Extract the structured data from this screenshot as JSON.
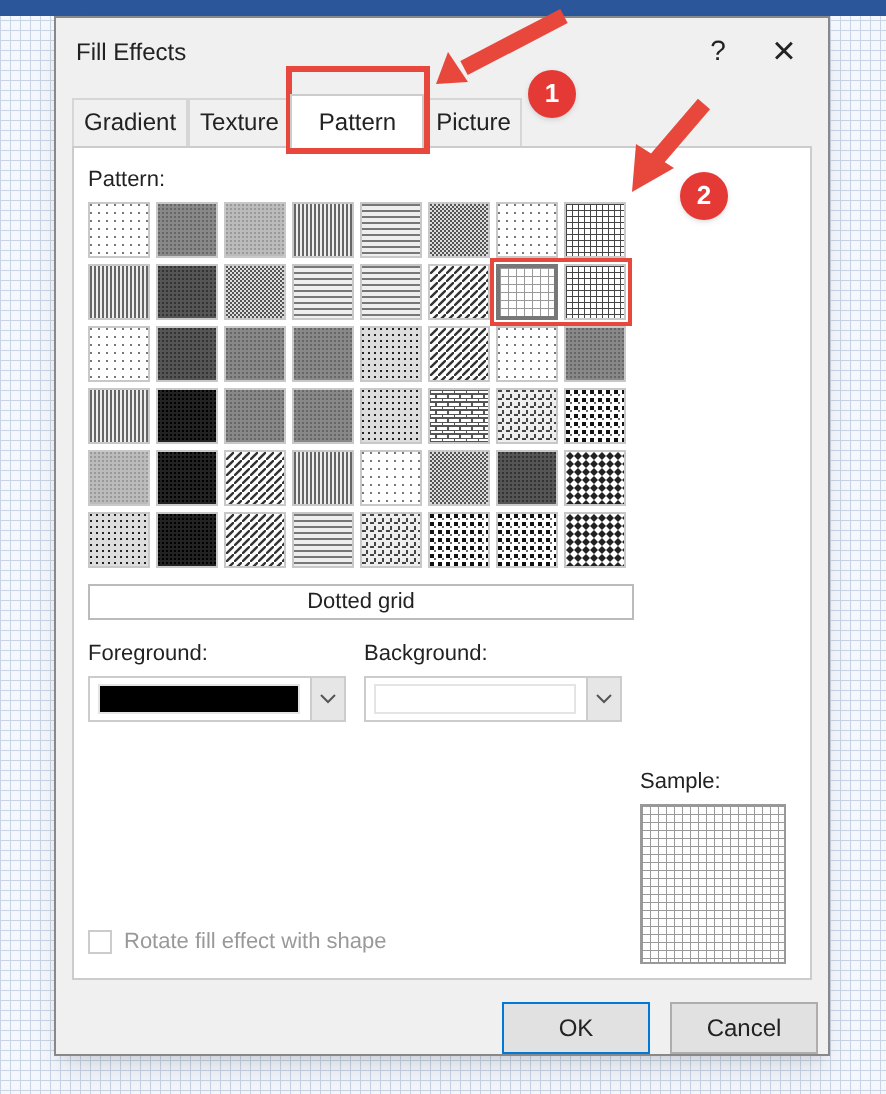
{
  "window": {
    "title": "Fill Effects",
    "help": "?",
    "close": "×"
  },
  "tabs": [
    {
      "label": "Gradient",
      "selected": false
    },
    {
      "label": "Texture",
      "selected": false
    },
    {
      "label": "Pattern",
      "selected": true
    },
    {
      "label": "Picture",
      "selected": false
    }
  ],
  "pattern_label": "Pattern:",
  "patterns": [
    {
      "kind": "sparse",
      "selected": false
    },
    {
      "kind": "gray50",
      "selected": false
    },
    {
      "kind": "gray25",
      "selected": false
    },
    {
      "kind": "vlines",
      "selected": false
    },
    {
      "kind": "hlines",
      "selected": false
    },
    {
      "kind": "checker",
      "selected": false
    },
    {
      "kind": "sparse",
      "selected": false
    },
    {
      "kind": "densegrid",
      "selected": false
    },
    {
      "kind": "vlines",
      "selected": false
    },
    {
      "kind": "gray75",
      "selected": false
    },
    {
      "kind": "checker",
      "selected": false
    },
    {
      "kind": "hlines",
      "selected": false
    },
    {
      "kind": "hlines",
      "selected": false
    },
    {
      "kind": "diag",
      "selected": false
    },
    {
      "kind": "grid",
      "selected": true
    },
    {
      "kind": "densegrid",
      "selected": false
    },
    {
      "kind": "sparse",
      "selected": false
    },
    {
      "kind": "gray75",
      "selected": false
    },
    {
      "kind": "gray50",
      "selected": false
    },
    {
      "kind": "gray50",
      "selected": false
    },
    {
      "kind": "dots",
      "selected": false
    },
    {
      "kind": "diag",
      "selected": false
    },
    {
      "kind": "sparse",
      "selected": false
    },
    {
      "kind": "gray50",
      "selected": false
    },
    {
      "kind": "vlines",
      "selected": false
    },
    {
      "kind": "gray90",
      "selected": false
    },
    {
      "kind": "gray50",
      "selected": false
    },
    {
      "kind": "gray50",
      "selected": false
    },
    {
      "kind": "dots",
      "selected": false
    },
    {
      "kind": "brick",
      "selected": false
    },
    {
      "kind": "weave",
      "selected": false
    },
    {
      "kind": "plaid",
      "selected": false
    },
    {
      "kind": "gray25",
      "selected": false
    },
    {
      "kind": "gray90",
      "selected": false
    },
    {
      "kind": "diag",
      "selected": false
    },
    {
      "kind": "vlines",
      "selected": false
    },
    {
      "kind": "sparse",
      "selected": false
    },
    {
      "kind": "checker",
      "selected": false
    },
    {
      "kind": "gray75",
      "selected": false
    },
    {
      "kind": "diamond",
      "selected": false
    },
    {
      "kind": "dots",
      "selected": false
    },
    {
      "kind": "gray90",
      "selected": false
    },
    {
      "kind": "diag",
      "selected": false
    },
    {
      "kind": "hlines",
      "selected": false
    },
    {
      "kind": "weave",
      "selected": false
    },
    {
      "kind": "plaid",
      "selected": false
    },
    {
      "kind": "plaid",
      "selected": false
    },
    {
      "kind": "diamond",
      "selected": false
    }
  ],
  "pattern_name": "Dotted grid",
  "foreground": {
    "label": "Foreground:",
    "color": "#000000"
  },
  "background": {
    "label": "Background:",
    "color": "#ffffff"
  },
  "sample_label": "Sample:",
  "rotate": {
    "label": "Rotate fill effect with shape",
    "checked": false,
    "disabled": true
  },
  "buttons": [
    {
      "label": "OK",
      "default": true
    },
    {
      "label": "Cancel",
      "default": false
    }
  ],
  "callouts": [
    {
      "number": "1"
    },
    {
      "number": "2"
    }
  ]
}
